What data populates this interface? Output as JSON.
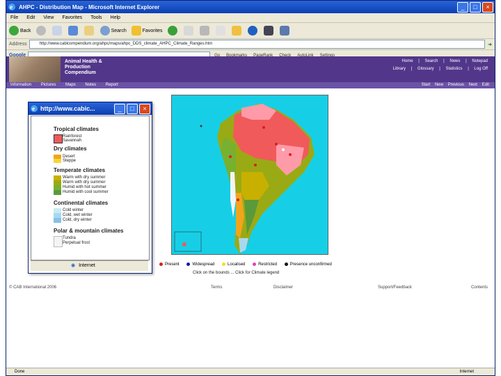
{
  "window": {
    "title": "AHPC - Distribution Map - Microsoft Internet Explorer"
  },
  "menu": [
    "File",
    "Edit",
    "View",
    "Favorites",
    "Tools",
    "Help"
  ],
  "toolbar": {
    "back": "Back",
    "search": "Search",
    "favorites": "Favorites"
  },
  "address": {
    "label": "Address",
    "url": "http://www.cabicompendium.org/ahpc/maps/ahpc_DDS_climate_AHPC_Climate_Ranges.htm"
  },
  "google": {
    "label": "Google",
    "items": [
      "Go",
      "Bookmarks",
      "PageRank",
      "Check",
      "AutoLink",
      "Settings"
    ]
  },
  "site": {
    "title_lines": [
      "Animal Health &",
      "Production",
      "Compendium"
    ],
    "links_top": [
      "Home",
      "|",
      "Search",
      "|",
      "News",
      "|",
      "Notepad"
    ],
    "links_bottom": [
      "Library",
      "|",
      "Glossary",
      "|",
      "Statistics",
      "|",
      "Log Off"
    ],
    "nav_left": [
      "Information",
      "Pictures",
      "Maps",
      "Notes",
      "Report"
    ],
    "nav_right": [
      "Start",
      "New",
      "Previous",
      "Next",
      "Edit"
    ]
  },
  "map_legend": [
    {
      "label": "Present",
      "color": "#d62020"
    },
    {
      "label": "Widespread",
      "color": "#1a1aa8"
    },
    {
      "label": "Localised",
      "color": "#f0e020"
    },
    {
      "label": "Restricted",
      "color": "#e040c0"
    },
    {
      "label": "Presence unconfirmed",
      "color": "#111111"
    }
  ],
  "map_note": "Click on the bounds ... Click for Climate legend",
  "footer": [
    "© CAB International 2006",
    "Terms",
    "Disclaimer",
    "Support/Feedback",
    "Contents"
  ],
  "status": {
    "left": "Done",
    "right": "Internet"
  },
  "popup": {
    "title": "http://www.cabic...",
    "status": "Internet",
    "groups": [
      {
        "title": "Tropical climates",
        "items": [
          {
            "label": "Rainforest",
            "color": "#f05a5a"
          },
          {
            "label": "Savannah",
            "color": "#ff9aa8"
          }
        ]
      },
      {
        "title": "Dry climates",
        "items": [
          {
            "label": "Desert",
            "color": "#f2a41c"
          },
          {
            "label": "Steppe",
            "color": "#f5d53a"
          }
        ]
      },
      {
        "title": "Temperate climates",
        "items": [
          {
            "label": "Warm with dry summer",
            "color": "#c8b000"
          },
          {
            "label": "Warm with dry summer",
            "color": "#9aaa14"
          },
          {
            "label": "Humid with hot summer",
            "color": "#78b030"
          },
          {
            "label": "Humid with cool summer",
            "color": "#5a9a3a"
          }
        ]
      },
      {
        "title": "Continental climates",
        "items": [
          {
            "label": "Cold winter",
            "color": "#c8ecf0"
          },
          {
            "label": "Cold, wet winter",
            "color": "#a8d8f0"
          },
          {
            "label": "Cold, dry winter",
            "color": "#88c0e8"
          }
        ]
      },
      {
        "title": "Polar & mountain climates",
        "items": [
          {
            "label": "Tundra",
            "color": "#f4f4f4"
          },
          {
            "label": "Perpetual frost",
            "color": "#ffffff"
          }
        ]
      }
    ]
  }
}
